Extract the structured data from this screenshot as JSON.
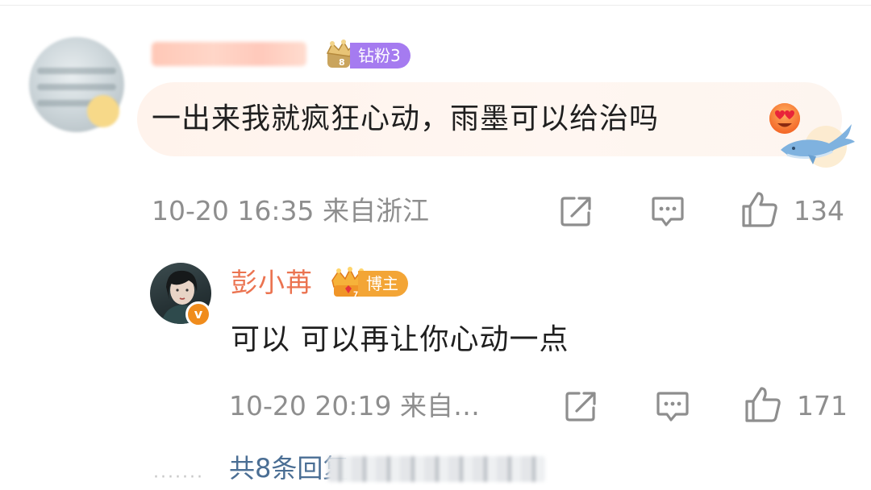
{
  "comment": {
    "fan_badge": "钻粉3",
    "text": "一出来我就疯狂心动，雨墨可以给治吗",
    "time_location": "10-20 16:35 来自浙江",
    "like_count": "134",
    "icons": [
      "share-icon",
      "comment-icon",
      "like-icon"
    ]
  },
  "reply": {
    "name": "彭小苒",
    "badge": "博主",
    "verified_mark": "v",
    "text": "可以 可以再让你心动一点",
    "time_location": "10-20 20:19 来自…",
    "like_count": "171"
  },
  "footer": {
    "dots": "·······",
    "more_replies": "共8条回复"
  },
  "colors": {
    "name_orange": "#eb7350",
    "fan_badge_purple": "#a57bf0",
    "blogger_badge_orange": "#f3a536",
    "link_blue": "#4a6e94",
    "meta_gray": "#8e8e8e"
  }
}
